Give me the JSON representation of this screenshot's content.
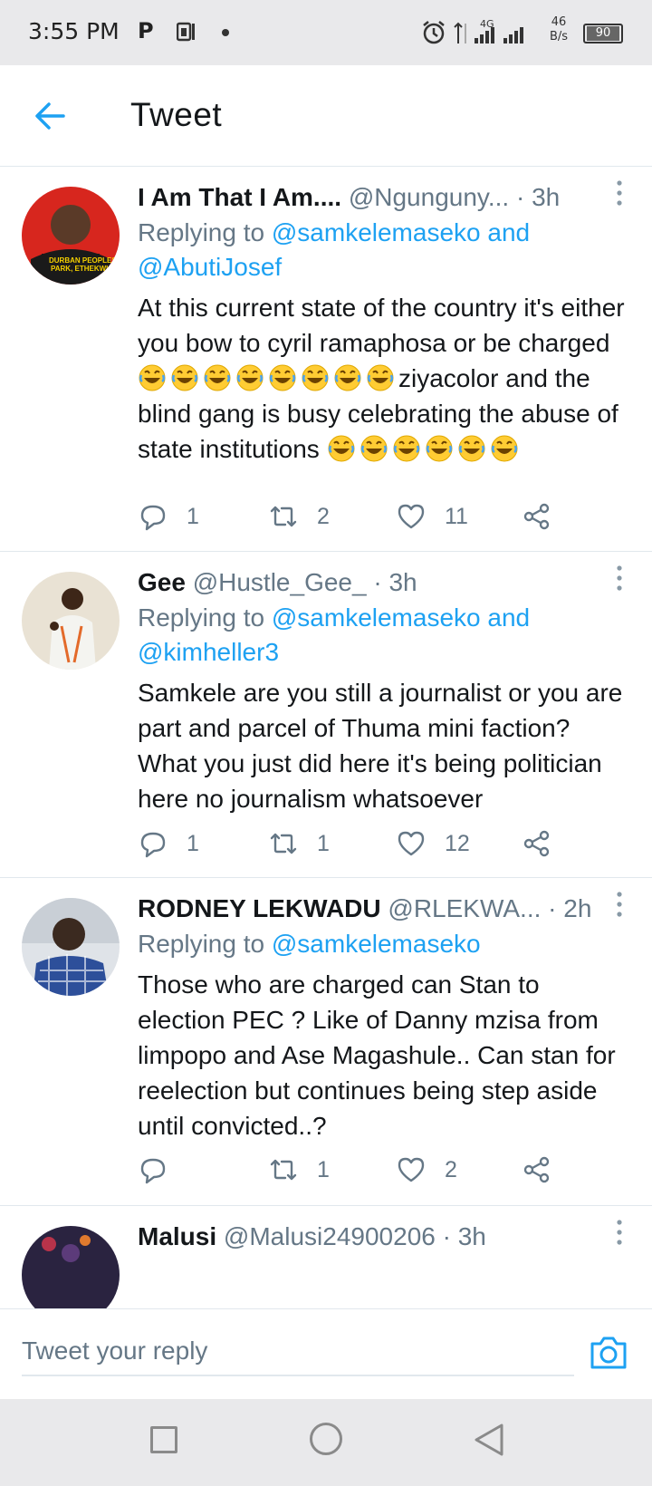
{
  "status_bar": {
    "time": "3:55 PM",
    "p_icon": "P",
    "network": "4G",
    "speed_value": "46",
    "speed_unit": "B/s",
    "battery": "90"
  },
  "header": {
    "title": "Tweet"
  },
  "tweets": [
    {
      "name": "I Am That I Am....",
      "handle": "@Ngunguny...",
      "time": "3h",
      "replying_prefix": "Replying to ",
      "mentions": [
        "@samkelemaseko",
        "@AbutiJosef"
      ],
      "mention_join": " and",
      "text_a": "At this current state of the country it's either you bow to cyril ramaphosa or be charged",
      "text_b": "ziyacolor and the blind gang is busy celebrating the abuse of state institutions ",
      "emoji_name": "rolling-on-floor-laughing",
      "replies": "1",
      "retweets": "2",
      "likes": "11"
    },
    {
      "name": "Gee",
      "handle": "@Hustle_Gee_",
      "time": "3h",
      "replying_prefix": "Replying to ",
      "mentions": [
        "@samkelemaseko",
        "@kimheller3"
      ],
      "mention_join": " and",
      "text": "Samkele are you still a journalist or you are part and parcel of Thuma mini faction? What you just did here it's being politician  here no journalism whatsoever",
      "replies": "1",
      "retweets": "1",
      "likes": "12"
    },
    {
      "name": "RODNEY  LEKWADU",
      "handle": "@RLEKWA...",
      "time": "2h",
      "replying_prefix": "Replying to ",
      "mentions": [
        "@samkelemaseko"
      ],
      "text": "Those who are charged can Stan to election PEC ? Like of Danny mzisa from limpopo and Ase Magashule.. Can stan for reelection but continues being step aside until convicted..?",
      "replies": "",
      "retweets": "1",
      "likes": "2"
    },
    {
      "name": "Malusi",
      "handle": "@Malusi24900206",
      "time": "3h"
    }
  ],
  "reply_bar": {
    "placeholder": "Tweet your reply",
    "camera_icon": "camera-icon"
  },
  "colors": {
    "accent": "#1da1f2",
    "secondary_text": "#657786",
    "primary_text": "#14171a"
  }
}
